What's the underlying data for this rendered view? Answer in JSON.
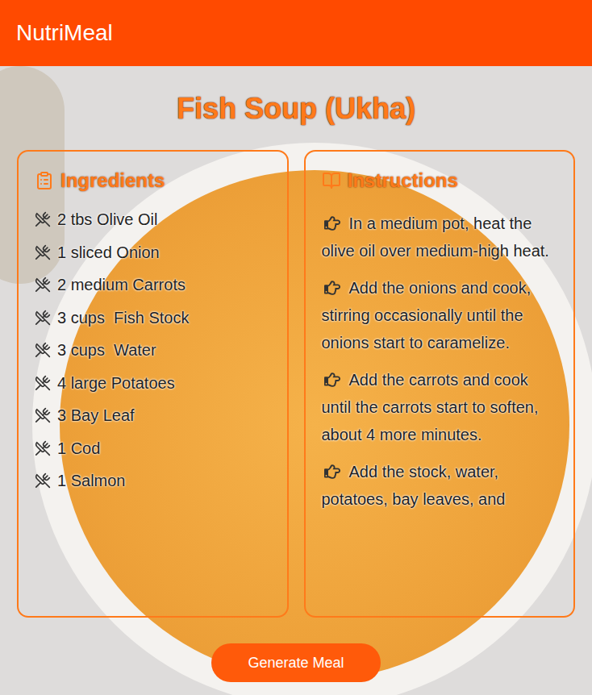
{
  "app": {
    "title": "NutriMeal"
  },
  "recipe": {
    "title": "Fish Soup (Ukha)"
  },
  "ingredients": {
    "heading": "Ingredients",
    "items": [
      "2 tbs Olive Oil",
      "1 sliced Onion",
      "2 medium Carrots",
      "3 cups  Fish Stock",
      "3 cups  Water",
      "4 large Potatoes",
      "3 Bay Leaf",
      "1 Cod",
      "1 Salmon"
    ]
  },
  "instructions": {
    "heading": "Instructions",
    "steps": [
      "In a medium pot, heat the olive oil over medium-high heat.",
      "Add the onions and cook, stirring occasionally until the onions start to caramelize.",
      "Add the carrots and cook until the carrots start to soften, about 4 more minutes.",
      "Add the stock, water, potatoes, bay leaves, and"
    ]
  },
  "buttons": [
    "Generate Meal"
  ]
}
